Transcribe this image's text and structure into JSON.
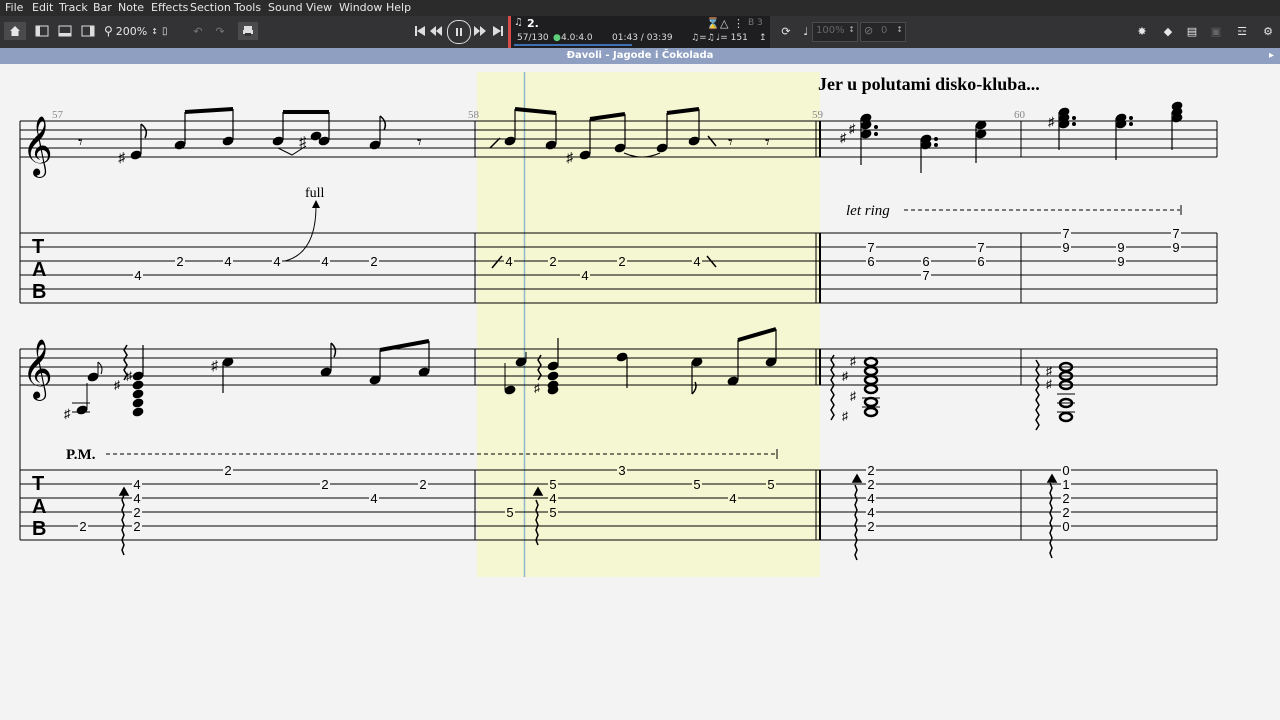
{
  "menu": [
    "File",
    "Edit",
    "Track",
    "Bar",
    "Note",
    "Effects",
    "Section",
    "Tools",
    "Sound",
    "View",
    "Window",
    "Help"
  ],
  "toolbar": {
    "zoom": "200%",
    "current_track": "2.",
    "bar_position": "57/130",
    "time_signature": "4.0:4.0",
    "time": "01:43 / 03:39",
    "tempo": "♩= 151",
    "bar_label": "B 3",
    "volume": "100%",
    "pan": "0"
  },
  "document_title": "Đavoli - Jagode i Čokolada",
  "score": {
    "lyric_text": "Jer u polutami disko-kluba...",
    "bar_numbers": [
      "57",
      "58",
      "59",
      "60"
    ],
    "bend_label": "full",
    "let_ring": "let ring",
    "palm_mute": "P.M.",
    "tab_clef": [
      "T",
      "A",
      "B"
    ],
    "staff1_tab": [
      {
        "fret": "4",
        "s": 4
      },
      {
        "fret": "2",
        "s": 3
      },
      {
        "fret": "4",
        "s": 3
      },
      {
        "fret": "4",
        "s": 3
      },
      {
        "fret": "4",
        "s": 3
      },
      {
        "fret": "2",
        "s": 3
      },
      {
        "fret": "4",
        "s": 3
      },
      {
        "fret": "2",
        "s": 3
      },
      {
        "fret": "4",
        "s": 4
      },
      {
        "fret": "2",
        "s": 3
      },
      {
        "fret": "4",
        "s": 3
      },
      {
        "fret": "7",
        "s": 2
      },
      {
        "fret": "6",
        "s": 3
      },
      {
        "fret": "6",
        "s": 3
      },
      {
        "fret": "7",
        "s": 4
      },
      {
        "fret": "7",
        "s": 2
      },
      {
        "fret": "6",
        "s": 3
      },
      {
        "fret": "7",
        "s": 1
      },
      {
        "fret": "9",
        "s": 2
      },
      {
        "fret": "9",
        "s": 2
      },
      {
        "fret": "9",
        "s": 3
      },
      {
        "fret": "7",
        "s": 1
      },
      {
        "fret": "9",
        "s": 2
      }
    ],
    "staff2_tab": [
      {
        "fret": "2",
        "s": 5
      },
      {
        "fret": "2",
        "s": 2
      },
      {
        "fret": "4",
        "s": 3
      },
      {
        "fret": "4",
        "s": 4
      },
      {
        "fret": "2",
        "s": 5
      },
      {
        "fret": "2",
        "s": 1
      },
      {
        "fret": "2",
        "s": 2
      },
      {
        "fret": "4",
        "s": 3
      },
      {
        "fret": "2",
        "s": 2
      },
      {
        "fret": "5",
        "s": 4
      },
      {
        "fret": "5",
        "s": 2
      },
      {
        "fret": "4",
        "s": 3
      },
      {
        "fret": "5",
        "s": 4
      },
      {
        "fret": "3",
        "s": 1
      },
      {
        "fret": "5",
        "s": 2
      },
      {
        "fret": "4",
        "s": 3
      },
      {
        "fret": "5",
        "s": 2
      },
      {
        "fret": "2",
        "s": 1
      },
      {
        "fret": "2",
        "s": 2
      },
      {
        "fret": "4",
        "s": 3
      },
      {
        "fret": "4",
        "s": 4
      },
      {
        "fret": "2",
        "s": 5
      },
      {
        "fret": "0",
        "s": 1
      },
      {
        "fret": "1",
        "s": 2
      },
      {
        "fret": "2",
        "s": 3
      },
      {
        "fret": "2",
        "s": 4
      },
      {
        "fret": "0",
        "s": 5
      }
    ]
  },
  "colors": {
    "menubar": "#2b2b2b",
    "toolbar": "#333335",
    "titlebar": "#8f9fc1",
    "highlight": "#f5f7d2",
    "cursor": "#8fb7c9",
    "accent_red": "#d94a4a"
  }
}
